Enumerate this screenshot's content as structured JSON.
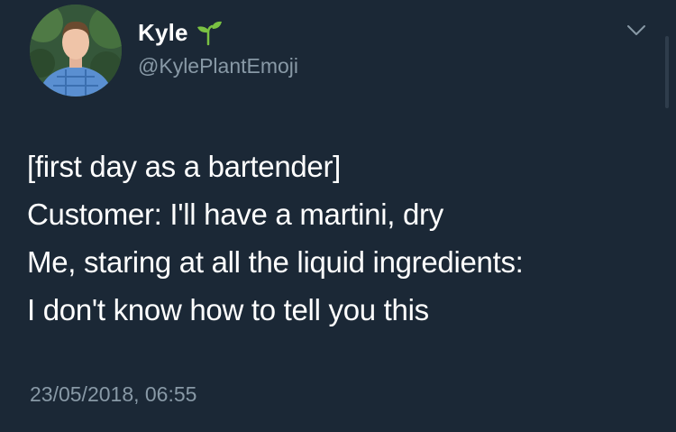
{
  "author": {
    "display_name": "Kyle",
    "handle": "@KylePlantEmoji",
    "name_emoji_icon": "seedling-icon"
  },
  "tweet": {
    "lines": [
      "[first day as a bartender]",
      "Customer: I'll have a martini, dry",
      "Me, staring at all the liquid ingredients:",
      "I don't know how to tell you this"
    ],
    "timestamp": "23/05/2018, 06:55"
  },
  "colors": {
    "background": "#1b2836",
    "primary_text": "#ffffff",
    "secondary_text": "#8899a6",
    "emoji_green": "#7ac142"
  },
  "icons": {
    "menu": "chevron-down-icon"
  }
}
